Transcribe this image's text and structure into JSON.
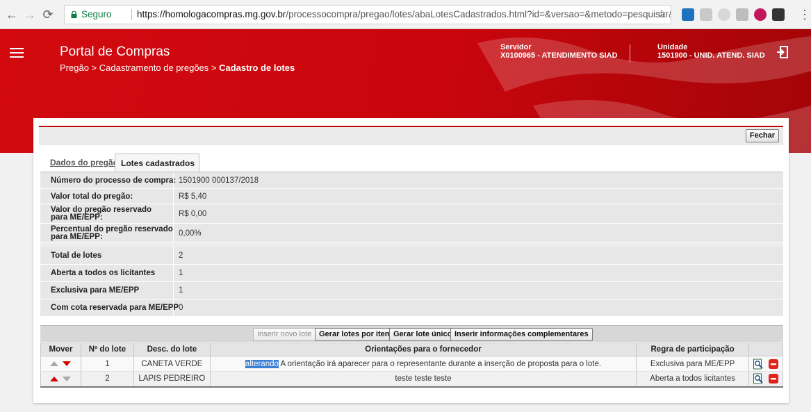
{
  "browser": {
    "secure_label": "Seguro",
    "url_host": "https://homologacompras.mg.gov.br",
    "url_path": "/processocompra/pregao/lotes/abaLotesCadastrados.html?id=&versao=&metodo=pesquisar&exi..."
  },
  "header": {
    "title": "Portal de Compras",
    "breadcrumb_prefix": "Pregão > Cadastramento de pregões > ",
    "breadcrumb_current": "Cadastro de lotes",
    "servidor_label": "Servidor",
    "servidor_value": "X0100965 - ATENDIMENTO SIAD",
    "unidade_label": "Unidade",
    "unidade_value": "1501900 - UNID. ATEND. SIAD"
  },
  "toolbar": {
    "close_label": "Fechar"
  },
  "tabs": [
    {
      "label": "Dados do pregão"
    },
    {
      "label": "Lotes cadastrados"
    }
  ],
  "info": {
    "numero_label": "Número do processo de compra:",
    "numero_value": "1501900 000137/2018",
    "valor_total_label": "Valor total do pregão:",
    "valor_total_value": "R$ 5,40",
    "valor_reservado_label": "Valor do pregão reservado para ME/EPP:",
    "valor_reservado_value": "R$ 0,00",
    "percentual_label": "Percentual do pregão reservado para ME/EPP:",
    "percentual_value": "0,00%",
    "total_lotes_label": "Total de lotes",
    "total_lotes_value": "2",
    "aberta_label": "Aberta a todos os licitantes",
    "aberta_value": "1",
    "exclusiva_label": "Exclusiva para ME/EPP",
    "exclusiva_value": "1",
    "cota_label": "Com cota reservada para ME/EPP",
    "cota_value": "0"
  },
  "actions": {
    "inserir_novo": "Inserir novo lote",
    "gerar_por_item": "Gerar lotes por item",
    "gerar_unico": "Gerar lote único",
    "inserir_info": "Inserir informações complementares"
  },
  "grid": {
    "headers": [
      "Mover",
      "Nº do lote",
      "Desc. do lote",
      "Orientações para o fornecedor",
      "Regra de participação",
      ""
    ],
    "rows": [
      {
        "numero": "1",
        "descricao": "CANETA VERDE",
        "orientacao_selected": "alterando",
        "orientacao_rest": " A orientação irá aparecer para o representante durante a inserção de proposta para o lote.",
        "regra": "Exclusiva para ME/EPP"
      },
      {
        "numero": "2",
        "descricao": "LAPIS PEDREIRO",
        "orientacao_selected": "",
        "orientacao_rest": "teste teste teste",
        "regra": "Aberta a todos licitantes"
      }
    ]
  },
  "colors": {
    "header_red": "#d20a10",
    "arrow_active": "#d40000",
    "arrow_inactive": "#a8a8a8",
    "selection": "#3b7ed6"
  }
}
